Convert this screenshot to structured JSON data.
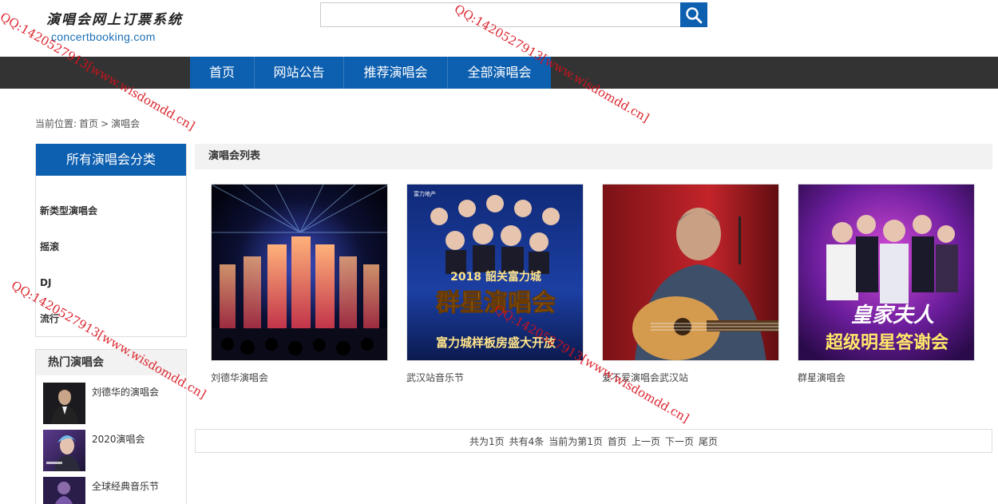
{
  "logo": {
    "title_cn": "演唱会网上订票系统",
    "domain": "concertbooking.com"
  },
  "search": {
    "placeholder": "",
    "button_icon": "search-icon"
  },
  "nav": {
    "items": [
      {
        "label": "首页"
      },
      {
        "label": "网站公告"
      },
      {
        "label": "推荐演唱会"
      },
      {
        "label": "全部演唱会"
      }
    ]
  },
  "breadcrumb": {
    "prefix": "当前位置:",
    "home": "首页",
    "separator": ">",
    "current": "演唱会"
  },
  "sidebar": {
    "category_title": "所有演唱会分类",
    "categories": [
      {
        "label": "新类型演唱会"
      },
      {
        "label": "摇滚"
      },
      {
        "label": "DJ"
      },
      {
        "label": "流行"
      }
    ],
    "hot_title": "热门演唱会",
    "hot_items": [
      {
        "label": "刘德华的演唱会"
      },
      {
        "label": "2020演唱会"
      },
      {
        "label": "全球经典音乐节"
      }
    ]
  },
  "main": {
    "list_title": "演唱会列表",
    "concerts": [
      {
        "title": "刘德华演唱会",
        "poster_text": ""
      },
      {
        "title": "武汉站音乐节",
        "poster_text": "群星演唱会",
        "poster_sub": "富力城样板房盛大开放",
        "poster_brand": "富力地产",
        "poster_year": "2018 韶关富力城"
      },
      {
        "title": "爱不爱演唱会武汉站",
        "poster_text": ""
      },
      {
        "title": "群星演唱会",
        "poster_text": "皇家夫人",
        "poster_sub": "超级明星答谢会"
      }
    ]
  },
  "pagination": {
    "total_pages": "共为1页",
    "total_items": "共有4条",
    "current": "当前为第1页",
    "first": "首页",
    "prev": "上一页",
    "next": "下一页",
    "last": "尾页"
  },
  "watermark": {
    "text": "QQ:1420527913[www.wisdomdd.cn]"
  },
  "colors": {
    "brand_blue": "#0d5fb0",
    "nav_bg": "#333333",
    "watermark_red": "#d8101a"
  }
}
